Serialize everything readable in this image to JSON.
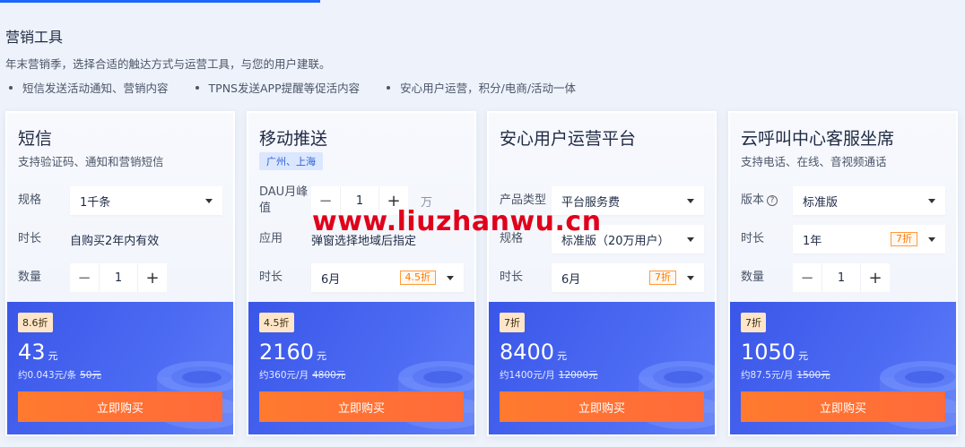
{
  "section": {
    "title": "营销工具",
    "desc": "年末营销季，选择合适的触达方式与运营工具，与您的用户建联。",
    "bullets": [
      "短信发送活动通知、营销内容",
      "TPNS发送APP提醒等促活内容",
      "安心用户运营，积分/电商/活动一体"
    ]
  },
  "cards": [
    {
      "title": "短信",
      "subtitle": "支持验证码、通知和营销短信",
      "spec_label": "规格",
      "spec_value": "1千条",
      "duration_label": "时长",
      "duration_value": "自购买2年内有效",
      "qty_label": "数量",
      "qty_value": "1",
      "discount": "8.6折",
      "price": "43",
      "price_unit": "元",
      "per": "约0.043元/条",
      "orig": "50元",
      "buy": "立即购买"
    },
    {
      "title": "移动推送",
      "region": "广州、上海",
      "dau_label": "DAU月峰值",
      "dau_value": "1",
      "dau_unit": "万",
      "app_label": "应用",
      "app_value": "弹窗选择地域后指定",
      "duration_label": "时长",
      "duration_value": "6月",
      "duration_disc": "4.5折",
      "discount": "4.5折",
      "price": "2160",
      "price_unit": "元",
      "per": "约360元/月",
      "orig": "4800元",
      "buy": "立即购买"
    },
    {
      "title": "安心用户运营平台",
      "type_label": "产品类型",
      "type_value": "平台服务费",
      "spec_label": "规格",
      "spec_value": "标准版（20万用户）",
      "duration_label": "时长",
      "duration_value": "6月",
      "duration_disc": "7折",
      "discount": "7折",
      "price": "8400",
      "price_unit": "元",
      "per": "约1400元/月",
      "orig": "12000元",
      "buy": "立即购买"
    },
    {
      "title": "云呼叫中心客服坐席",
      "subtitle": "支持电话、在线、音视频通话",
      "edition_label": "版本",
      "edition_value": "标准版",
      "duration_label": "时长",
      "duration_value": "1年",
      "duration_disc": "7折",
      "qty_label": "数量",
      "qty_value": "1",
      "discount": "7折",
      "price": "1050",
      "price_unit": "元",
      "per": "约87.5元/月",
      "orig": "1500元",
      "buy": "立即购买"
    }
  ],
  "watermark": "www.liuzhanwu.cn",
  "colors": {
    "accent": "#1e66ff",
    "price_bg": "#4461ee",
    "buy": "#ff7430",
    "watermark": "#e0001b"
  }
}
